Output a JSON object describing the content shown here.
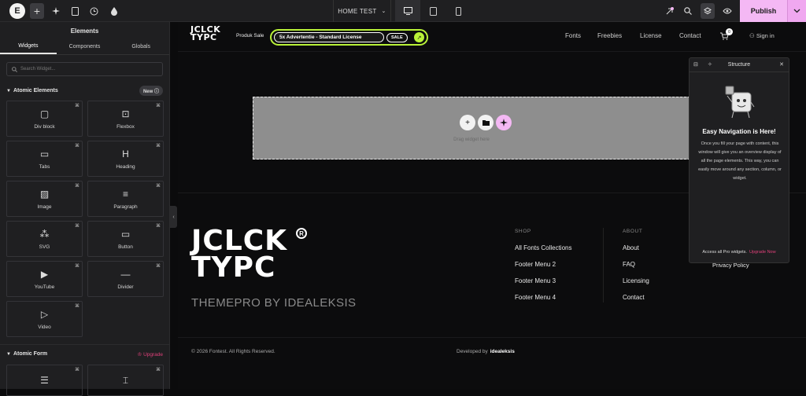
{
  "topbar": {
    "logo_glyph": "E",
    "add_glyph": "+",
    "page_name": "HOME TEST",
    "publish_label": "Publish"
  },
  "panel": {
    "title": "Elements",
    "tabs": [
      "Widgets",
      "Components",
      "Globals"
    ],
    "search_placeholder": "Search Widget...",
    "atomic_elements": {
      "title": "Atomic Elements",
      "badge": "New",
      "widgets": [
        {
          "label": "Div block",
          "icon": "div-block-icon",
          "glyph": "▢"
        },
        {
          "label": "Flexbox",
          "icon": "flexbox-icon",
          "glyph": "⊡"
        },
        {
          "label": "Tabs",
          "icon": "tabs-icon",
          "glyph": "▭"
        },
        {
          "label": "Heading",
          "icon": "heading-icon",
          "glyph": "H"
        },
        {
          "label": "Image",
          "icon": "image-icon",
          "glyph": "▨"
        },
        {
          "label": "Paragraph",
          "icon": "paragraph-icon",
          "glyph": "≡"
        },
        {
          "label": "SVG",
          "icon": "svg-icon",
          "glyph": "⁂"
        },
        {
          "label": "Button",
          "icon": "button-icon",
          "glyph": "▭"
        },
        {
          "label": "YouTube",
          "icon": "youtube-icon",
          "glyph": "▶"
        },
        {
          "label": "Divider",
          "icon": "divider-icon",
          "glyph": "—"
        },
        {
          "label": "Video",
          "icon": "video-icon",
          "glyph": "▷"
        }
      ]
    },
    "atomic_form": {
      "title": "Atomic Form",
      "upgrade": "Upgrade"
    }
  },
  "site": {
    "logo_line1": "JCLCK",
    "logo_line2": "TYPC",
    "produk_sale": "Produk Sale",
    "promo_text": "5x Advertentie - Standard License",
    "sale_badge": "SALE",
    "nav": [
      "Fonts",
      "Freebies",
      "License",
      "Contact"
    ],
    "cart_count": "0",
    "sign_in": "Sign in"
  },
  "dropzone": {
    "text": "Drag widget here"
  },
  "footer": {
    "tagline": "THEMEPRO BY IDEALEKSIS",
    "shop": {
      "heading": "SHOP",
      "items": [
        "All Fonts Collections",
        "Footer Menu 2",
        "Footer Menu 3",
        "Footer Menu 4"
      ]
    },
    "about": {
      "heading": "ABOUT",
      "items": [
        "About",
        "FAQ",
        "Licensing",
        "Contact"
      ]
    },
    "privacy": "Privacy Policy",
    "copyright": "© 2026 Fontest. All Rights Reserved.",
    "developed_by": "Developed by",
    "developer": "idealeksis"
  },
  "structure": {
    "title": "Structure",
    "heading": "Easy Navigation is Here!",
    "body": "Once you fill your page with content, this window will give you an overview display of all the page elements. This way, you can easily move around any section, column, or widget.",
    "footer_text": "Access all Pro widgets.",
    "footer_link": "Upgrade Now"
  },
  "colors": {
    "accent_green": "#b9f238",
    "publish_pink": "#f4b8f4",
    "upgrade_pink": "#e0407a"
  }
}
